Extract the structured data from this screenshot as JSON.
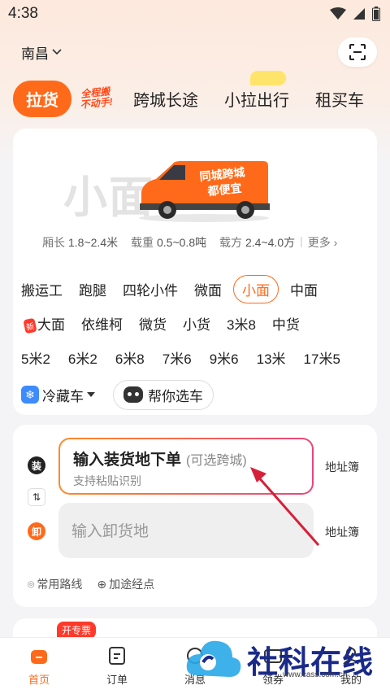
{
  "status": {
    "time": "4:38"
  },
  "header": {
    "city": "南昌"
  },
  "tabs": {
    "active": "拉货",
    "badge_line1": "全程搬",
    "badge_line2": "不动手!",
    "items": [
      "跨城长途",
      "小拉出行",
      "租买车"
    ]
  },
  "vehicle": {
    "watermark": "小面",
    "van_text_1": "同城跨城",
    "van_text_2": "都便宜",
    "specs": {
      "length_label": "厢长",
      "length_value": "1.8~2.4米",
      "weight_label": "载重",
      "weight_value": "0.5~0.8吨",
      "volume_label": "载方",
      "volume_value": "2.4~4.0方",
      "more": "更多"
    },
    "rows": [
      [
        "搬运工",
        "跑腿",
        "四轮小件",
        "微面",
        "小面",
        "中面"
      ],
      [
        "大面",
        "依维柯",
        "微货",
        "小货",
        "3米8",
        "中货"
      ],
      [
        "5米2",
        "6米2",
        "6米8",
        "7米6",
        "9米6",
        "13米",
        "17米5"
      ]
    ],
    "selected": "小面",
    "new_tag": "新",
    "cold_label": "冷藏车",
    "helper_label": "帮你选车"
  },
  "address": {
    "load_dot": "装",
    "unload_dot": "卸",
    "load_title": "输入装货地下单",
    "load_hint": "(可选跨城)",
    "load_sub": "支持粘贴识别",
    "unload_placeholder": "输入卸货地",
    "book_label": "地址簿",
    "common_routes": "常用路线",
    "add_stop": "加途经点"
  },
  "promo": {
    "tag": "开专票"
  },
  "nav": [
    {
      "label": "首页",
      "icon": "home-icon"
    },
    {
      "label": "订单",
      "icon": "order-icon"
    },
    {
      "label": "消息",
      "icon": "message-icon"
    },
    {
      "label": "领券",
      "icon": "coupon-icon"
    },
    {
      "label": "我的",
      "icon": "profile-icon"
    }
  ],
  "watermark": {
    "text": "社科在线",
    "url": "www.cass.com.cn"
  },
  "colors": {
    "accent": "#ff6a1a",
    "gradient_end": "#e8457a",
    "arrow": "#d6203a"
  }
}
